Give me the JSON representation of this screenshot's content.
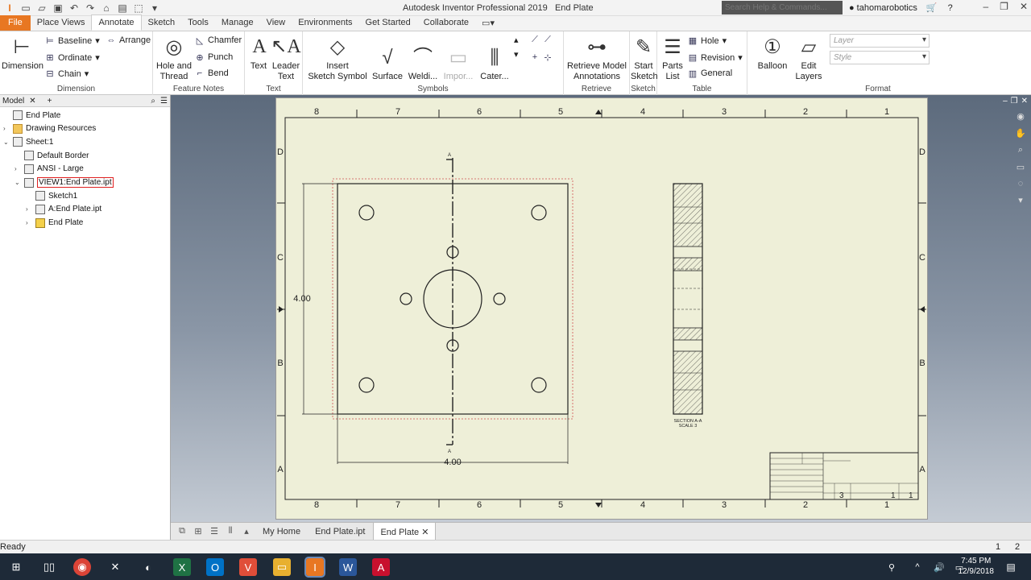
{
  "window": {
    "title": "Autodesk Inventor Professional 2019",
    "doc_title": "End Plate",
    "help_placeholder": "Search Help & Commands...",
    "user": "tahomarobotics"
  },
  "tabs": [
    {
      "label": "File",
      "type": "file"
    },
    {
      "label": "Place Views"
    },
    {
      "label": "Annotate",
      "active": true
    },
    {
      "label": "Sketch"
    },
    {
      "label": "Tools"
    },
    {
      "label": "Manage"
    },
    {
      "label": "View"
    },
    {
      "label": "Environments"
    },
    {
      "label": "Get Started"
    },
    {
      "label": "Collaborate"
    }
  ],
  "ribbon": {
    "dimension": {
      "title": "Dimension",
      "big": "Dimension",
      "baseline": "Baseline",
      "arrange": "Arrange",
      "ordinate": "Ordinate",
      "chain": "Chain"
    },
    "feature_notes": {
      "title": "Feature Notes",
      "hole": "Hole and\nThread",
      "chamfer": "Chamfer",
      "punch": "Punch",
      "bend": "Bend"
    },
    "text": {
      "title": "Text",
      "text": "Text",
      "leader": "Leader\nText"
    },
    "symbols": {
      "title": "Symbols",
      "insert": "Insert\nSketch Symbol",
      "surface": "Surface",
      "welding": "Weldi...",
      "import": "Impor...",
      "caterpillar": "Cater..."
    },
    "retrieve": {
      "title": "Retrieve",
      "retrieve": "Retrieve Model\nAnnotations"
    },
    "sketch": {
      "title": "Sketch",
      "start": "Start\nSketch"
    },
    "table": {
      "title": "Table",
      "parts": "Parts\nList",
      "hole": "Hole",
      "revision": "Revision",
      "general": "General"
    },
    "balloon": {
      "label": "Balloon"
    },
    "layers": {
      "label": "Edit\nLayers"
    },
    "format": {
      "title": "Format",
      "layer": "Layer",
      "style": "Style"
    }
  },
  "browser": {
    "tab": "Model",
    "items": [
      {
        "label": "End Plate",
        "level": 0,
        "twist": "",
        "icon": "drawing-icon"
      },
      {
        "label": "Drawing Resources",
        "level": 0,
        "twist": "›",
        "icon": "folder-icon"
      },
      {
        "label": "Sheet:1",
        "level": 0,
        "twist": "⌄",
        "icon": "sheet-icon"
      },
      {
        "label": "Default Border",
        "level": 1,
        "twist": "",
        "icon": "border-icon"
      },
      {
        "label": "ANSI - Large",
        "level": 1,
        "twist": "›",
        "icon": "titleblock-icon"
      },
      {
        "label": "VIEW1:End Plate.ipt",
        "level": 1,
        "twist": "⌄",
        "icon": "view-icon",
        "selected": true
      },
      {
        "label": "Sketch1",
        "level": 2,
        "twist": "",
        "icon": "sketch-icon"
      },
      {
        "label": "A:End Plate.ipt",
        "level": 2,
        "twist": "›",
        "icon": "section-view-icon"
      },
      {
        "label": "End Plate",
        "level": 2,
        "twist": "›",
        "icon": "part-icon"
      }
    ]
  },
  "drawing": {
    "zones_top": [
      "8",
      "7",
      "6",
      "5",
      "4",
      "3",
      "2",
      "1"
    ],
    "zones_side": [
      "D",
      "C",
      "B",
      "A"
    ],
    "dim_height": "4.00",
    "dim_width": "4.00",
    "section_marker": "A",
    "section_label_1": "SECTION A-A",
    "section_label_2": "SCALE 3",
    "titleblock_sheet": "3",
    "titleblock_n1": "1",
    "titleblock_n2": "1"
  },
  "doc_tabs": [
    {
      "label": "My Home"
    },
    {
      "label": "End Plate.ipt"
    },
    {
      "label": "End Plate",
      "active": true
    }
  ],
  "status": {
    "text": "Ready",
    "count1": "1",
    "count2": "2"
  },
  "clock": {
    "time": "7:45 PM",
    "date": "12/9/2018"
  }
}
